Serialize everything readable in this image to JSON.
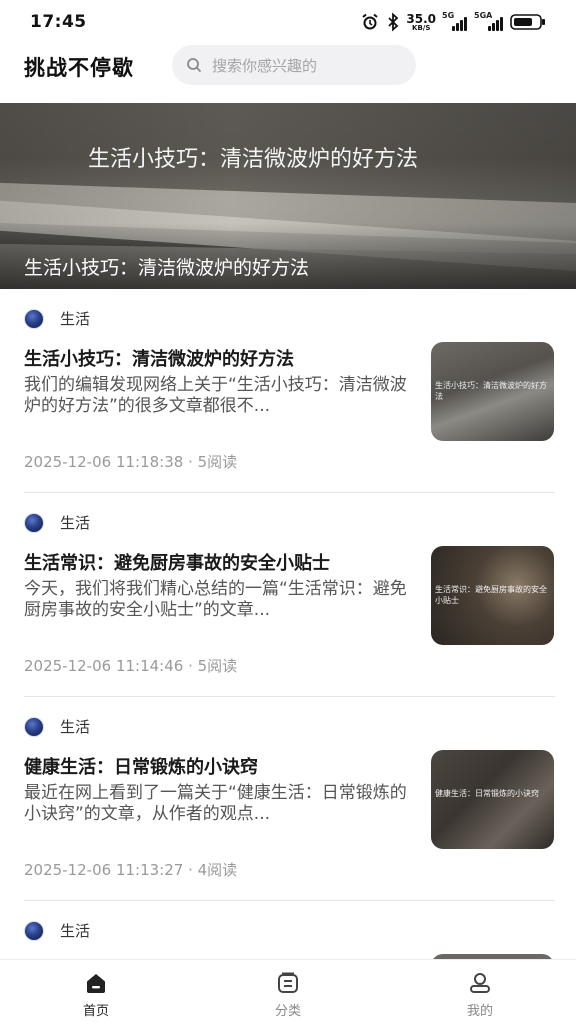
{
  "status_bar": {
    "time": "17:45",
    "net_speed_value": "35.0",
    "net_speed_unit": "KB/S",
    "signal1_label": "5G",
    "signal2_label": "5GA"
  },
  "header": {
    "title": "挑战不停歇",
    "search_placeholder": "搜索你感兴趣的"
  },
  "banner": {
    "image_title": "生活小技巧：清洁微波炉的好方法",
    "caption": "生活小技巧：清洁微波炉的好方法"
  },
  "articles": [
    {
      "category": "生活",
      "title": "生活小技巧：清洁微波炉的好方法",
      "summary": "我们的编辑发现网络上关于“生活小技巧：清洁微波炉的好方法”的很多文章都很不...",
      "meta": "2025-12-06 11:18:38 · 5阅读",
      "thumb_caption": "生活小技巧：清洁微波炉的好方法"
    },
    {
      "category": "生活",
      "title": "生活常识：避免厨房事故的安全小贴士",
      "summary": "今天，我们将我们精心总结的一篇“生活常识：避免厨房事故的安全小贴士”的文章...",
      "meta": "2025-12-06 11:14:46 · 5阅读",
      "thumb_caption": "生活常识：避免厨房事故的安全小贴士"
    },
    {
      "category": "生活",
      "title": "健康生活：日常锻炼的小诀窍",
      "summary": "最近在网上看到了一篇关于“健康生活：日常锻炼的小诀窍”的文章，从作者的观点...",
      "meta": "2025-12-06 11:13:27 · 4阅读",
      "thumb_caption": "健康生活：日常锻炼的小诀窍"
    },
    {
      "category": "生活"
    }
  ],
  "bottom_nav": {
    "items": [
      {
        "label": "首页",
        "icon": "home-icon",
        "active": true
      },
      {
        "label": "分类",
        "icon": "category-icon",
        "active": false
      },
      {
        "label": "我的",
        "icon": "profile-icon",
        "active": false
      }
    ]
  }
}
